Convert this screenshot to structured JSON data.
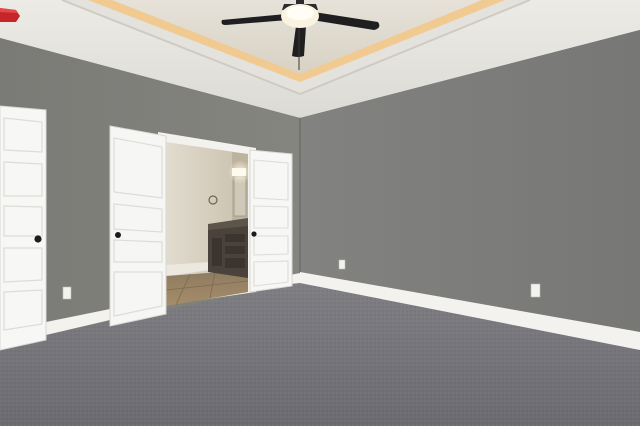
{
  "scene": {
    "kind": "empty-bedroom-interior",
    "wall_color": "#7b7b78",
    "ceiling_color": "#efeeea",
    "carpet_color": "#77767b",
    "trim_color": "#f5f5f2",
    "cove_light_color": "#f5c98a",
    "fan_blade_color": "#1f1f21",
    "bath_wall_color": "#d9d2c3",
    "tile_color": "#9a8364",
    "vanity_color": "#4a423b",
    "smoke_detector_color": "#c8252a"
  }
}
